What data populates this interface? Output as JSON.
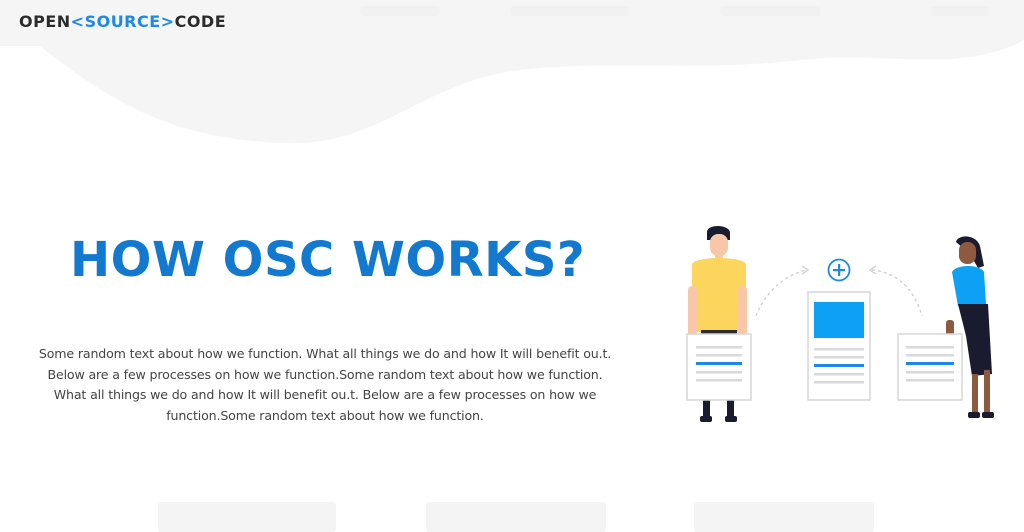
{
  "header": {
    "logo": {
      "part1": "OPEN",
      "lt": "<",
      "part2": "SOURCE",
      "gt": ">",
      "part3": "CODE"
    }
  },
  "hero": {
    "title": "HOW OSC WORKS?",
    "description": "Some random text about how we function. What all things we do and how It will benefit ou.t. Below are a few processes on how we function.Some random text about how we function. What all things we do and how It will benefit ou.t. Below are a few processes on how we function.Some random text about how we function."
  },
  "colors": {
    "accent": "#1e88e5",
    "title": "#1279cf",
    "background_wave": "#f5f5f5",
    "illustration_blue": "#0ea0f5",
    "shirt_yellow": "#fcd55c"
  },
  "illustration": {
    "icons": [
      "person-icon",
      "plus-circle-icon",
      "document-icon"
    ]
  }
}
